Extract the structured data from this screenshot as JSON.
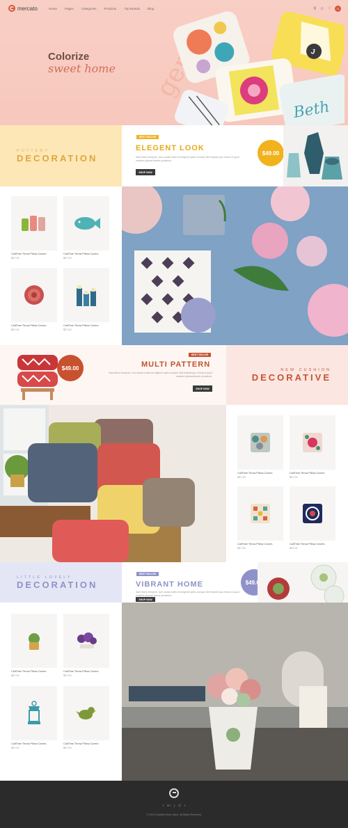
{
  "brand": {
    "name": "mercato"
  },
  "nav": {
    "menu": [
      "Home",
      "Pages",
      "Categories",
      "Products",
      "Top Brands",
      "Blog"
    ],
    "icons": [
      "search-icon",
      "user-icon",
      "heart-icon",
      "cart-icon"
    ],
    "cart_count": "0"
  },
  "hero": {
    "title": "Colorize",
    "subtitle": "sweet home",
    "deco_text": "gentle",
    "pillow_text": "Beth",
    "pillow_letter": "J"
  },
  "pottery": {
    "label_small": "POTTERY",
    "label_big": "DECORATION",
    "badge": "BEST SELLER",
    "title": "ELEGENT LOOK",
    "text": "Nam libero tempore, cum soluta nobis est eligendi optio cumque nihil impedit quo minus id quod maxime placeat facere possimus.",
    "button": "SHOP NOW",
    "price": "$49.00",
    "colors": {
      "label_bg": "#fde7b7",
      "label_text": "#e7b24a",
      "badge_bg": "#f1b21d",
      "title": "#e7a91b",
      "price_bg": "#f1b21d"
    }
  },
  "cushion": {
    "label_small": "NEW CUSHION",
    "label_big": "DECORATIVE",
    "badge": "BEST SELLER",
    "title": "MULTI PATTERN",
    "text": "Nam libero tempore, cum soluta nobis est eligendi optio cumque nihil impedit quo minus id quod maxime placeat facere possimus.",
    "button": "SHOP NOW",
    "price": "$49.00",
    "colors": {
      "label_bg": "#fbe6e1",
      "label_text": "#c8512f",
      "badge_bg": "#c8512f",
      "title": "#c0522e",
      "price_bg": "#c8512f"
    }
  },
  "vibrant": {
    "label_small": "LITTLE LOVELY",
    "label_big": "DECORATION",
    "badge": "BEST SELLER",
    "title": "VIBRANT HOME",
    "text": "Nam libero tempore, cum soluta nobis est eligendi optio cumque nihil impedit quo minus id quod maxime placeat facere possimus.",
    "button": "SHOP NOW",
    "price": "$49.00",
    "colors": {
      "label_bg": "#e5e6f5",
      "label_text": "#8f92c9",
      "badge_bg": "#8f92c9",
      "title": "#8f92c9",
      "price_bg": "#8f92c9"
    }
  },
  "products_pottery": [
    {
      "name": "CallTime Throw Pillow Covers",
      "price": "$57.00",
      "icon": "mugs-icon"
    },
    {
      "name": "CallTime Throw Pillow Covers",
      "price": "$57.00",
      "icon": "fish-plate-icon"
    },
    {
      "name": "CallTime Throw Pillow Covers",
      "price": "$57.00",
      "icon": "flower-bowl-icon"
    },
    {
      "name": "CallTime Throw Pillow Covers",
      "price": "$57.00",
      "icon": "candles-icon"
    }
  ],
  "products_cushion": [
    {
      "name": "CallTime Throw Pillow Covers",
      "price": "$57.00",
      "icon": "scale-pillow-icon"
    },
    {
      "name": "CallTime Throw Pillow Covers",
      "price": "$57.00",
      "icon": "floral-pillow-icon"
    },
    {
      "name": "CallTime Throw Pillow Covers",
      "price": "$57.00",
      "icon": "geo-pillow-icon"
    },
    {
      "name": "CallTime Throw Pillow Covers",
      "price": "$57.00",
      "icon": "mandala-pillow-icon"
    }
  ],
  "products_vibrant": [
    {
      "name": "CallTime Throw Pillow Covers",
      "price": "$57.00",
      "icon": "succulent-icon"
    },
    {
      "name": "CallTime Throw Pillow Covers",
      "price": "$57.00",
      "icon": "flowers-icon"
    },
    {
      "name": "CallTime Throw Pillow Covers",
      "price": "$57.00",
      "icon": "lantern-icon"
    },
    {
      "name": "CallTime Throw Pillow Covers",
      "price": "$57.00",
      "icon": "bird-icon"
    }
  ],
  "footer": {
    "social": [
      "f",
      "G+",
      "ʃ",
      "ⓟ",
      "t"
    ],
    "copyright": "© 2016 Createtie Demo Store. All Rights Reserved."
  }
}
